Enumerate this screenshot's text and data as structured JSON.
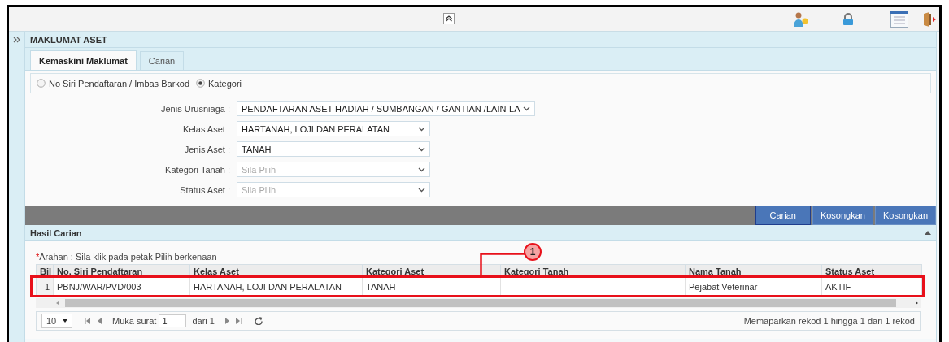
{
  "panel": {
    "title": "MAKLUMAT ASET"
  },
  "tabs": [
    {
      "label": "Kemaskini Maklumat",
      "selected": true
    },
    {
      "label": "Carian",
      "selected": false
    }
  ],
  "search_mode": [
    {
      "label": "No Siri Pendaftaran / Imbas Barkod",
      "selected": false
    },
    {
      "label": "Kategori",
      "selected": true
    }
  ],
  "form": [
    {
      "label": "Jenis Urusniaga :",
      "value": "PENDAFTARAN ASET HADIAH / SUMBANGAN / GANTIAN /LAIN-LA",
      "kind": "wide"
    },
    {
      "label": "Kelas Aset :",
      "value": "HARTANAH, LOJI DAN PERALATAN",
      "kind": "standard"
    },
    {
      "label": "Jenis Aset :",
      "value": "TANAH",
      "kind": "standard"
    },
    {
      "label": "Kategori Tanah :",
      "placeholder": "Sila Pilih",
      "kind": "standard"
    },
    {
      "label": "Status Aset :",
      "placeholder": "Sila Pilih",
      "kind": "standard"
    }
  ],
  "buttons": [
    {
      "label": "Carian",
      "focused": true
    },
    {
      "label": "Kosongkan",
      "focused": false
    },
    {
      "label": "Kosongkan",
      "focused": false
    }
  ],
  "results": {
    "title": "Hasil Carian",
    "required_mark": "*",
    "note": "Arahan : Sila klik pada petak Pilih berkenaan",
    "columns": [
      "Bil",
      "No. Siri Pendaftaran",
      "Kelas Aset",
      "Kategori Aset",
      "Kategori Tanah",
      "Nama Tanah",
      "Status Aset"
    ],
    "rows": [
      [
        "1",
        "PBNJ/WAR/PVD/003",
        "HARTANAH, LOJI DAN PERALATAN",
        "TANAH",
        null,
        "Pejabat Veterinar",
        "AKTIF"
      ]
    ],
    "pager": {
      "page_size": "10",
      "page_label": "Muka surat",
      "page": "1",
      "page_total": "dari 1",
      "summary": "Memaparkan rekod 1 hingga 1 dari 1 rekod"
    }
  },
  "annotation": {
    "callout": "1"
  }
}
